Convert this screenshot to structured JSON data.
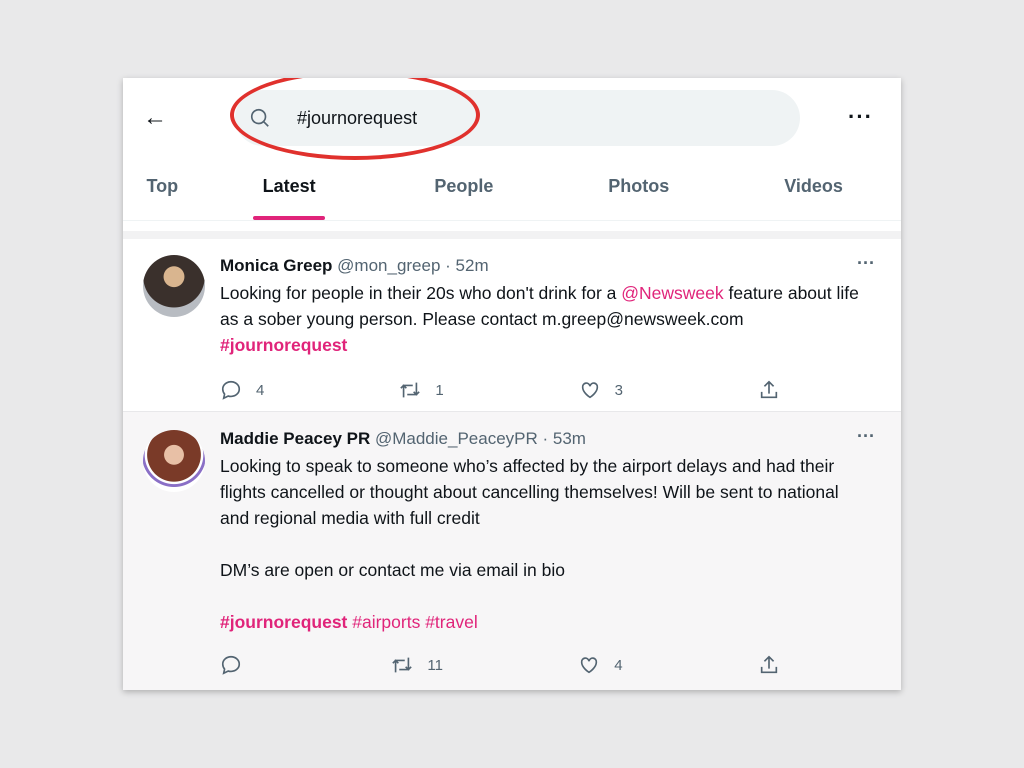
{
  "header": {
    "search_value": "#journorequest",
    "back_icon": "arrow-left-icon",
    "more_icon": "more-horizontal-icon"
  },
  "tabs": [
    {
      "label": "Top"
    },
    {
      "label": "Latest",
      "active": true
    },
    {
      "label": "People"
    },
    {
      "label": "Photos"
    },
    {
      "label": "Videos"
    }
  ],
  "colors": {
    "accent": "#e0247a",
    "annotation": "#e0312d"
  },
  "tweets": [
    {
      "name": "Monica Greep",
      "handle": "@mon_greep",
      "time": "· 52m",
      "text_1": "Looking for people in their 20s who don't drink for a ",
      "mention": "@Newsweek",
      "text_2": " feature about life as a sober young person. Please contact m.greep@newsweek.com ",
      "hashtag": "#journorequest",
      "replies": "4",
      "retweets": "1",
      "likes": "3"
    },
    {
      "name": "Maddie Peacey PR",
      "handle": "@Maddie_PeaceyPR",
      "time": "· 53m",
      "text_1": "Looking to speak to someone who’s affected by the airport delays and had their flights cancelled or thought about cancelling themselves! Will be sent to national and regional media with full credit",
      "text_2": "DM’s are open or contact me via email in bio",
      "hashtag": "#journorequest",
      "hashtag_2": " #airports #travel",
      "replies": "",
      "retweets": "11",
      "likes": "4"
    }
  ]
}
